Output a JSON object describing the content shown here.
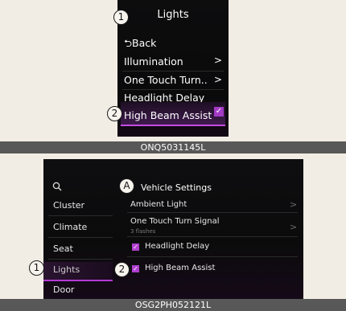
{
  "top_panel": {
    "marker": "1",
    "title": "Lights",
    "items": [
      {
        "label": "⮌Back",
        "has_arrow": false
      },
      {
        "label": "Illumination",
        "has_arrow": true
      },
      {
        "label": "One Touch Turn..",
        "has_arrow": true
      },
      {
        "label": "Headlight Delay",
        "has_arrow": false
      },
      {
        "label": "High Beam Assist",
        "checked": true
      }
    ],
    "highlight_marker": "2",
    "arrow_glyph": ">",
    "check_glyph": "✓",
    "caption": "ONQ5031145L"
  },
  "bottom_panel": {
    "title_marker": "A",
    "title": "Vehicle Settings",
    "sidebar": [
      "Cluster",
      "Climate",
      "Seat",
      "Lights",
      "Door"
    ],
    "sidebar_active_marker": "1",
    "settings": [
      {
        "label": "Ambient Light",
        "has_arrow": true
      },
      {
        "label": "One Touch Turn Signal",
        "sub": "3 flashes",
        "has_arrow": true
      },
      {
        "label": "Headlight Delay",
        "checked": true
      },
      {
        "label": "High Beam Assist",
        "checked": true
      }
    ],
    "setting_marker": "2",
    "arrow_glyph": ">",
    "check_glyph": "✓",
    "caption": "OSG2PH052121L"
  },
  "colors": {
    "accent": "#b43ad6",
    "panel_bg": "#0d0d0e",
    "page_bg": "#f2ede4",
    "caption_bg": "#585858"
  }
}
